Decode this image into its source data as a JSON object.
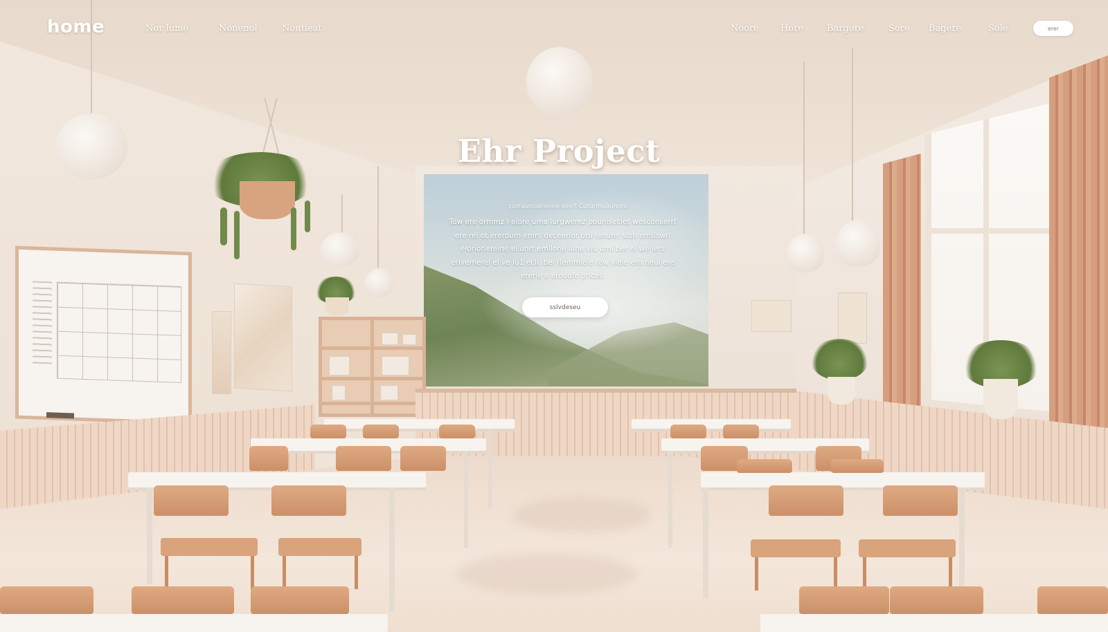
{
  "brand": {
    "logo_text": "home"
  },
  "nav": {
    "left_links": [
      "Nor lume",
      "Nonenol",
      "Noutieat"
    ],
    "right_links": [
      "Noore",
      "Hore",
      "Bargore",
      "Sore",
      "Bagere",
      "Sole"
    ],
    "cta_label": "erer"
  },
  "hero": {
    "title": "Ehr Project",
    "tagline": "curraunsulrenne sevrl Cuturmuaunoni",
    "body": "Tow ere ormmz I elore uma lurgwerez pouniseciet wesconserrf ere rel ot ereroum emrs deceerior oru lenunn sloh emtiswrl eloriorlerelne eliunrt emilone lune viu uml ber el we lers erivernerel el ve lu1 ecli. bei rlemmiele fow viele ero neui ere ererle o eroodfe pricet.",
    "cta_label": "sslvdeseu"
  },
  "colors": {
    "wall": "#efe4da",
    "wood": "#d9a37c",
    "curtain": "#d59f7f",
    "cta_background": "#ffffff"
  }
}
